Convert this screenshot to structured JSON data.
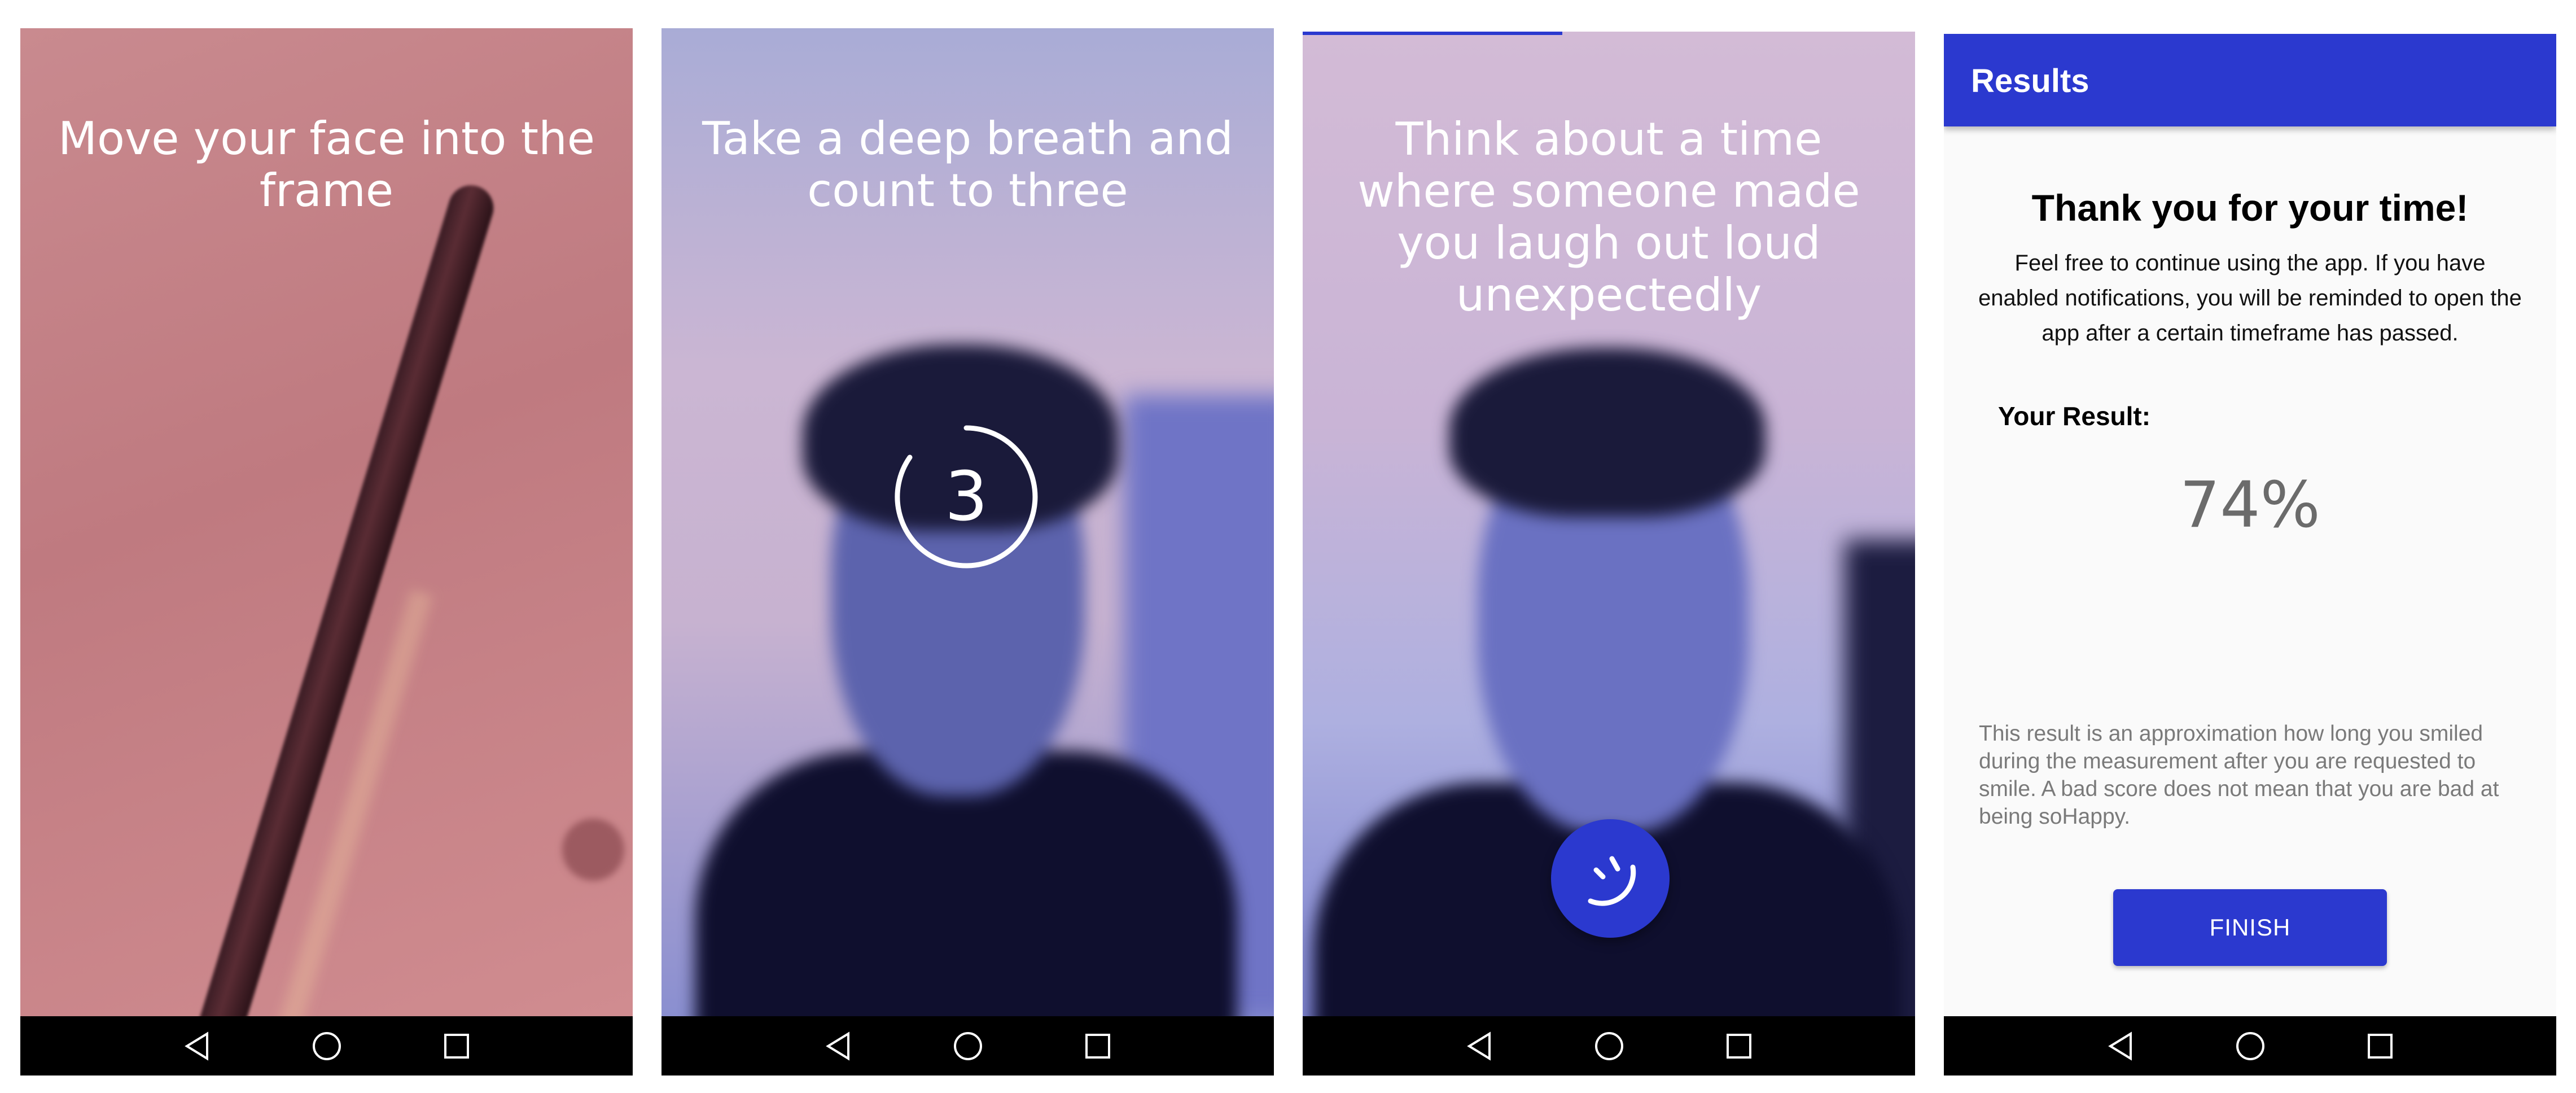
{
  "screens": [
    {
      "prompt": "Move your face into the frame"
    },
    {
      "prompt": "Take a deep breath and count to three",
      "countdown": "3"
    },
    {
      "prompt": "Think about a time where someone made you laugh out loud unexpectedly"
    }
  ],
  "results": {
    "title": "Results",
    "thanks": "Thank you for your time!",
    "description": "Feel free to continue using the app. If you have enabled notifications, you will be reminded to open the app after a certain timeframe has passed.",
    "result_label": "Your Result:",
    "result_value": "74%",
    "disclaimer": "This result is an approximation how long you smiled during the measurement after you are requested to smile. A bad score does not mean that you are bad at being soHappy.",
    "finish_label": "FINISH"
  },
  "navbar": {
    "icons": [
      "back-icon",
      "home-icon",
      "recents-icon"
    ]
  },
  "colors": {
    "primary": "#2b39cf",
    "navbar": "#000000"
  }
}
